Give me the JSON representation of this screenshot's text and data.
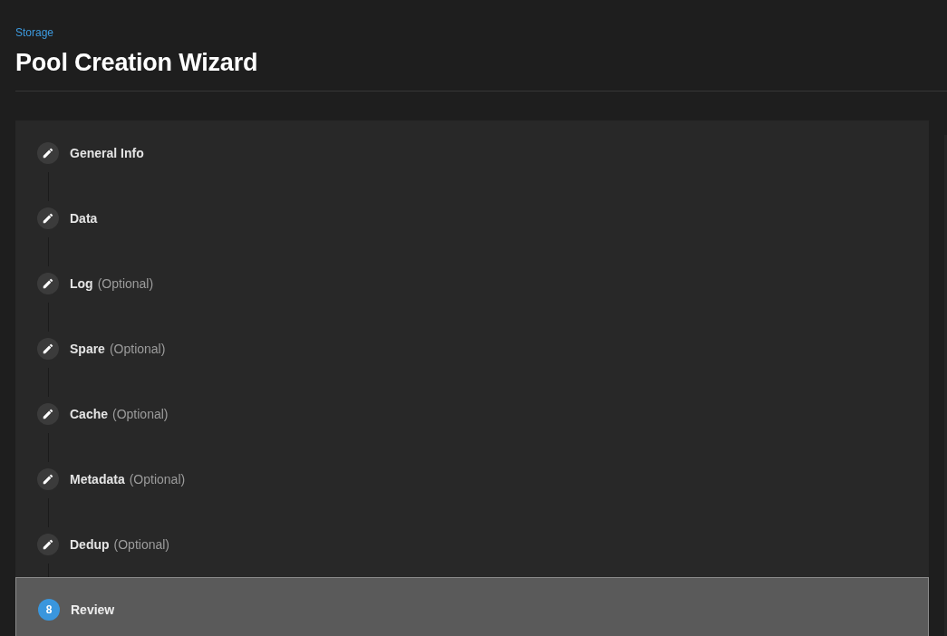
{
  "breadcrumb": "Storage",
  "title": "Pool Creation Wizard",
  "steps": [
    {
      "kind": "edit",
      "label": "General Info",
      "selected": false
    },
    {
      "kind": "edit",
      "label": "Data",
      "selected": false
    },
    {
      "kind": "edit",
      "label": "Log",
      "note": "(Optional)",
      "selected": false
    },
    {
      "kind": "edit",
      "label": "Spare",
      "note": "(Optional)",
      "selected": false
    },
    {
      "kind": "edit",
      "label": "Cache",
      "note": "(Optional)",
      "selected": false
    },
    {
      "kind": "edit",
      "label": "Metadata",
      "note": "(Optional)",
      "selected": false
    },
    {
      "kind": "edit",
      "label": "Dedup",
      "note": "(Optional)",
      "selected": false
    },
    {
      "kind": "number",
      "number": "8",
      "label": "Review",
      "selected": true
    }
  ]
}
